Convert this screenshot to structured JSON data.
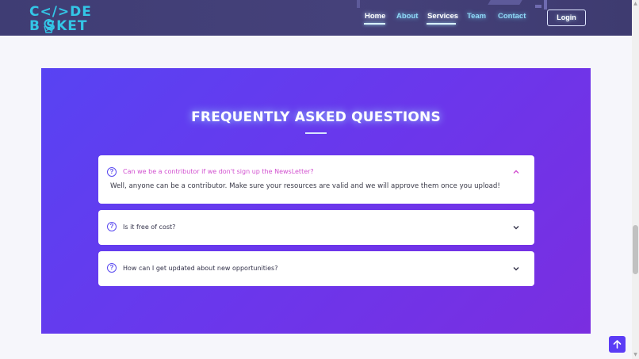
{
  "header": {
    "logo_top": "C</>DE",
    "logo_bottom": "B SKET",
    "nav": [
      {
        "label": "Home",
        "active": true
      },
      {
        "label": "About",
        "active": false
      },
      {
        "label": "Services",
        "active": true
      },
      {
        "label": "Team",
        "active": false
      },
      {
        "label": "Contact",
        "active": false
      }
    ],
    "login_label": "Login"
  },
  "faq": {
    "title": "FREQUENTLY ASKED QUESTIONS",
    "items": [
      {
        "question": "Can we be a contributor if we don't sign up the NewsLetter?",
        "answer": "Well, anyone can be a contributor. Make sure your resources are valid and we will approve them once you upload!",
        "expanded": true
      },
      {
        "question": "Is it free of cost?",
        "expanded": false
      },
      {
        "question": "How can I get updated about new opportunities?",
        "expanded": false
      }
    ],
    "question_icon_glyph": "?"
  },
  "icons": {
    "question": "question-circle-icon",
    "chevron_up": "chevron-up-icon",
    "chevron_down": "chevron-down-icon",
    "arrow_up": "arrow-up-icon"
  },
  "colors": {
    "header_bg": "#413e76",
    "logo": "#33c6e6",
    "nav_link": "#8fd9f7",
    "section_start": "#5843f3",
    "section_end": "#7a2ee0",
    "question_open": "#d14fcf",
    "accent": "#5b3cf5"
  }
}
